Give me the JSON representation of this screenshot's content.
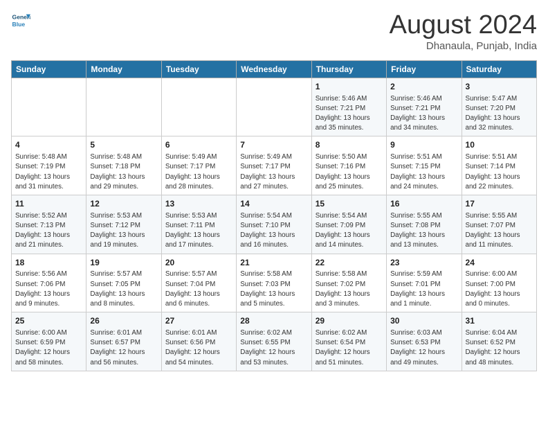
{
  "header": {
    "logo_line1": "General",
    "logo_line2": "Blue",
    "month": "August 2024",
    "location": "Dhanaula, Punjab, India"
  },
  "weekdays": [
    "Sunday",
    "Monday",
    "Tuesday",
    "Wednesday",
    "Thursday",
    "Friday",
    "Saturday"
  ],
  "weeks": [
    [
      {
        "day": "",
        "detail": ""
      },
      {
        "day": "",
        "detail": ""
      },
      {
        "day": "",
        "detail": ""
      },
      {
        "day": "",
        "detail": ""
      },
      {
        "day": "1",
        "detail": "Sunrise: 5:46 AM\nSunset: 7:21 PM\nDaylight: 13 hours\nand 35 minutes."
      },
      {
        "day": "2",
        "detail": "Sunrise: 5:46 AM\nSunset: 7:21 PM\nDaylight: 13 hours\nand 34 minutes."
      },
      {
        "day": "3",
        "detail": "Sunrise: 5:47 AM\nSunset: 7:20 PM\nDaylight: 13 hours\nand 32 minutes."
      }
    ],
    [
      {
        "day": "4",
        "detail": "Sunrise: 5:48 AM\nSunset: 7:19 PM\nDaylight: 13 hours\nand 31 minutes."
      },
      {
        "day": "5",
        "detail": "Sunrise: 5:48 AM\nSunset: 7:18 PM\nDaylight: 13 hours\nand 29 minutes."
      },
      {
        "day": "6",
        "detail": "Sunrise: 5:49 AM\nSunset: 7:17 PM\nDaylight: 13 hours\nand 28 minutes."
      },
      {
        "day": "7",
        "detail": "Sunrise: 5:49 AM\nSunset: 7:17 PM\nDaylight: 13 hours\nand 27 minutes."
      },
      {
        "day": "8",
        "detail": "Sunrise: 5:50 AM\nSunset: 7:16 PM\nDaylight: 13 hours\nand 25 minutes."
      },
      {
        "day": "9",
        "detail": "Sunrise: 5:51 AM\nSunset: 7:15 PM\nDaylight: 13 hours\nand 24 minutes."
      },
      {
        "day": "10",
        "detail": "Sunrise: 5:51 AM\nSunset: 7:14 PM\nDaylight: 13 hours\nand 22 minutes."
      }
    ],
    [
      {
        "day": "11",
        "detail": "Sunrise: 5:52 AM\nSunset: 7:13 PM\nDaylight: 13 hours\nand 21 minutes."
      },
      {
        "day": "12",
        "detail": "Sunrise: 5:53 AM\nSunset: 7:12 PM\nDaylight: 13 hours\nand 19 minutes."
      },
      {
        "day": "13",
        "detail": "Sunrise: 5:53 AM\nSunset: 7:11 PM\nDaylight: 13 hours\nand 17 minutes."
      },
      {
        "day": "14",
        "detail": "Sunrise: 5:54 AM\nSunset: 7:10 PM\nDaylight: 13 hours\nand 16 minutes."
      },
      {
        "day": "15",
        "detail": "Sunrise: 5:54 AM\nSunset: 7:09 PM\nDaylight: 13 hours\nand 14 minutes."
      },
      {
        "day": "16",
        "detail": "Sunrise: 5:55 AM\nSunset: 7:08 PM\nDaylight: 13 hours\nand 13 minutes."
      },
      {
        "day": "17",
        "detail": "Sunrise: 5:55 AM\nSunset: 7:07 PM\nDaylight: 13 hours\nand 11 minutes."
      }
    ],
    [
      {
        "day": "18",
        "detail": "Sunrise: 5:56 AM\nSunset: 7:06 PM\nDaylight: 13 hours\nand 9 minutes."
      },
      {
        "day": "19",
        "detail": "Sunrise: 5:57 AM\nSunset: 7:05 PM\nDaylight: 13 hours\nand 8 minutes."
      },
      {
        "day": "20",
        "detail": "Sunrise: 5:57 AM\nSunset: 7:04 PM\nDaylight: 13 hours\nand 6 minutes."
      },
      {
        "day": "21",
        "detail": "Sunrise: 5:58 AM\nSunset: 7:03 PM\nDaylight: 13 hours\nand 5 minutes."
      },
      {
        "day": "22",
        "detail": "Sunrise: 5:58 AM\nSunset: 7:02 PM\nDaylight: 13 hours\nand 3 minutes."
      },
      {
        "day": "23",
        "detail": "Sunrise: 5:59 AM\nSunset: 7:01 PM\nDaylight: 13 hours\nand 1 minute."
      },
      {
        "day": "24",
        "detail": "Sunrise: 6:00 AM\nSunset: 7:00 PM\nDaylight: 13 hours\nand 0 minutes."
      }
    ],
    [
      {
        "day": "25",
        "detail": "Sunrise: 6:00 AM\nSunset: 6:59 PM\nDaylight: 12 hours\nand 58 minutes."
      },
      {
        "day": "26",
        "detail": "Sunrise: 6:01 AM\nSunset: 6:57 PM\nDaylight: 12 hours\nand 56 minutes."
      },
      {
        "day": "27",
        "detail": "Sunrise: 6:01 AM\nSunset: 6:56 PM\nDaylight: 12 hours\nand 54 minutes."
      },
      {
        "day": "28",
        "detail": "Sunrise: 6:02 AM\nSunset: 6:55 PM\nDaylight: 12 hours\nand 53 minutes."
      },
      {
        "day": "29",
        "detail": "Sunrise: 6:02 AM\nSunset: 6:54 PM\nDaylight: 12 hours\nand 51 minutes."
      },
      {
        "day": "30",
        "detail": "Sunrise: 6:03 AM\nSunset: 6:53 PM\nDaylight: 12 hours\nand 49 minutes."
      },
      {
        "day": "31",
        "detail": "Sunrise: 6:04 AM\nSunset: 6:52 PM\nDaylight: 12 hours\nand 48 minutes."
      }
    ]
  ]
}
